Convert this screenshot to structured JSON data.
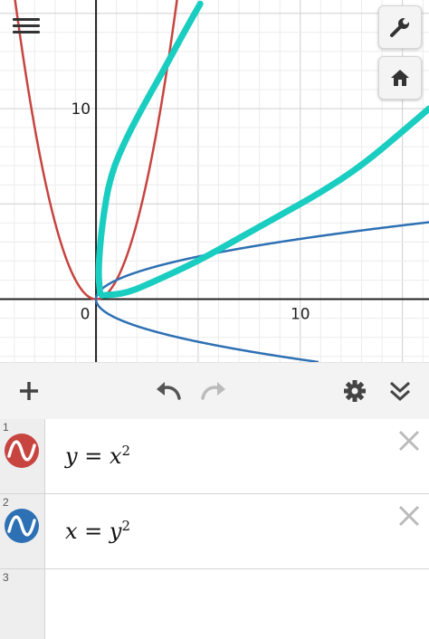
{
  "graph": {
    "x_labels": [
      {
        "value": 0,
        "text": "0"
      },
      {
        "value": 10,
        "text": "10"
      }
    ],
    "y_labels": [
      {
        "value": 10,
        "text": "10"
      }
    ],
    "x_range": [
      -4.7,
      16.3
    ],
    "y_range": [
      -3.3,
      15.7
    ],
    "colors": {
      "parabola": "#c74440",
      "sideways": "#2d70b3",
      "drawing": "#19cdc0"
    }
  },
  "buttons": {
    "menu_icon": "hamburger-icon",
    "settings_icon": "wrench-icon",
    "home_icon": "home-icon"
  },
  "toolbar": {
    "add_icon": "plus-icon",
    "undo_icon": "undo-icon",
    "redo_icon": "redo-icon",
    "gear_icon": "gear-icon",
    "collapse_icon": "double-chevron-down-icon"
  },
  "expressions": [
    {
      "index": "1",
      "lhs": "y",
      "eq": " = ",
      "base": "x",
      "exp": "2",
      "color": "#c74440"
    },
    {
      "index": "2",
      "lhs": "x",
      "eq": " = ",
      "base": "y",
      "exp": "2",
      "color": "#2d70b3"
    },
    {
      "index": "3"
    }
  ]
}
